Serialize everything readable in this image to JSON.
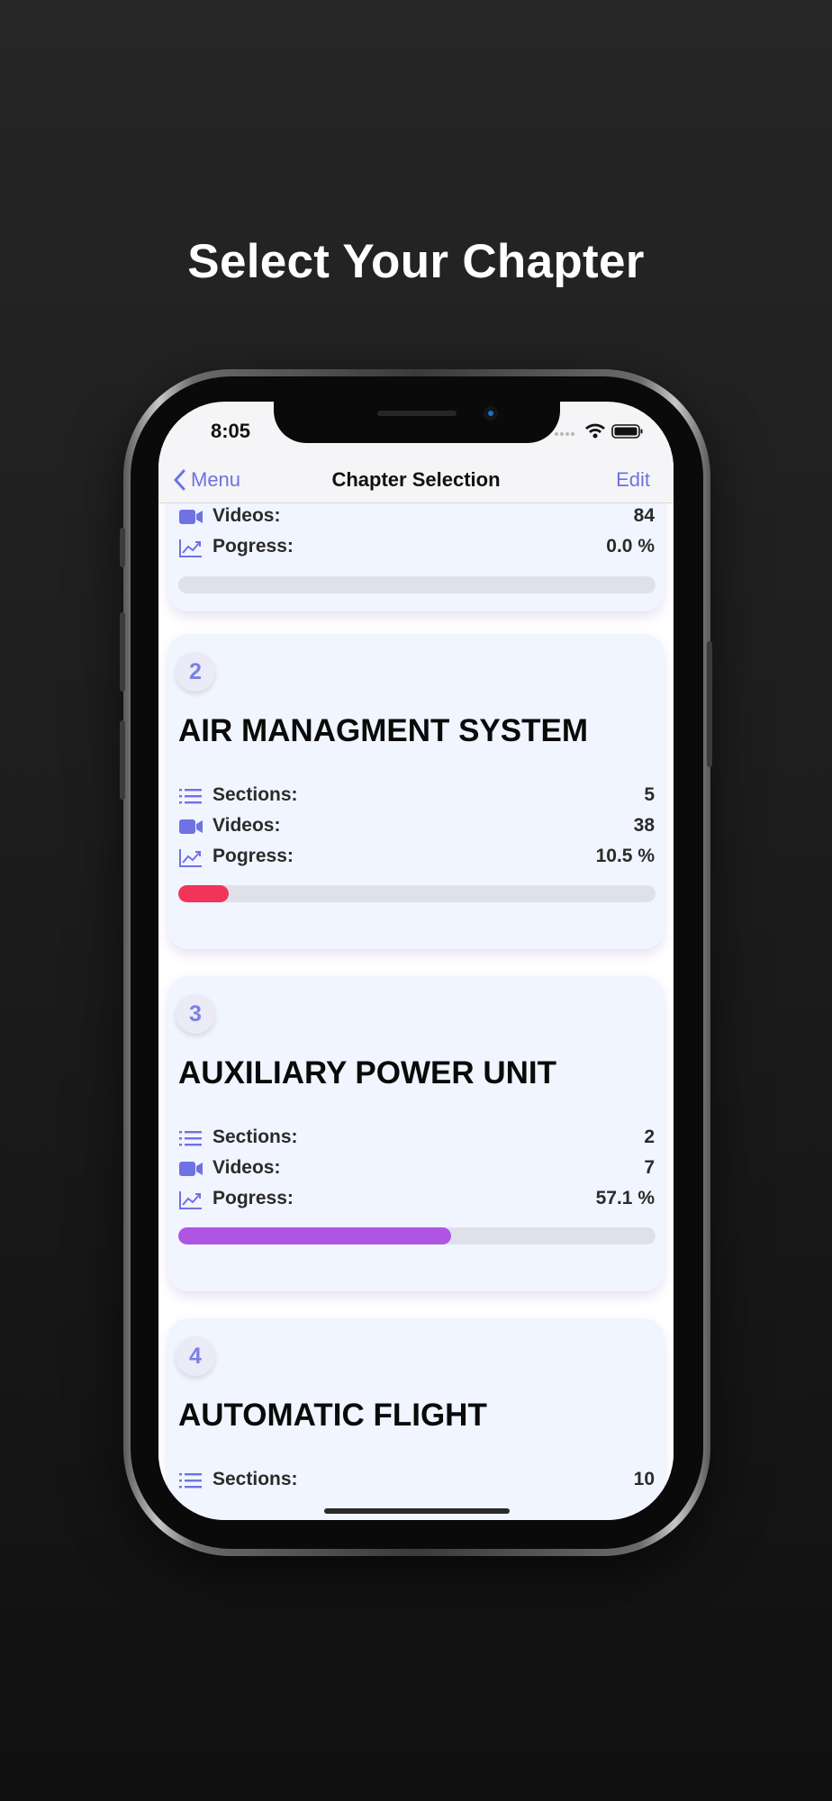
{
  "promo": {
    "title": "Select Your Chapter"
  },
  "status_bar": {
    "time": "8:05"
  },
  "navbar": {
    "back_label": "Menu",
    "title": "Chapter Selection",
    "edit_label": "Edit"
  },
  "labels": {
    "sections": "Sections:",
    "videos": "Videos:",
    "progress": "Pogress:"
  },
  "chapters": [
    {
      "videos": "84",
      "progress": "0.0 %",
      "progress_value": 0.0
    },
    {
      "number": "2",
      "title": "AIR MANAGMENT SYSTEM",
      "sections": "5",
      "videos": "38",
      "progress": "10.5 %",
      "progress_value": 0.105
    },
    {
      "number": "3",
      "title": "AUXILIARY POWER UNIT",
      "sections": "2",
      "videos": "7",
      "progress": "57.1 %",
      "progress_value": 0.571
    },
    {
      "number": "4",
      "title": "AUTOMATIC FLIGHT",
      "sections": "10"
    }
  ],
  "colors": {
    "accent": "#6f72e3",
    "progress_low": "#f2335a",
    "progress_mid": "#b054e3",
    "card_bg": "#f1f5ff",
    "track": "#dfe1ea"
  },
  "icons": {
    "sections": "list-icon",
    "videos": "video-camera-icon",
    "progress": "chart-line-icon",
    "back": "chevron-left-icon"
  }
}
